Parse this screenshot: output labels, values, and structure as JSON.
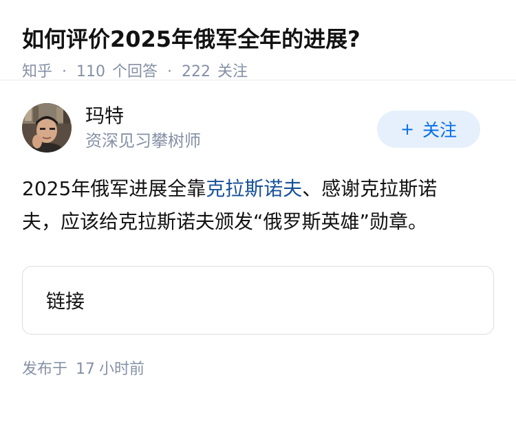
{
  "question": {
    "title": "如何评价2025年俄军全年的进展?",
    "source": "知乎",
    "answer_count": "110",
    "answer_label": "个回答",
    "follower_count": "222",
    "follower_label": "关注",
    "separator": "·"
  },
  "answer": {
    "author": {
      "name": "玛特",
      "bio": "资深见习攀树师",
      "avatar_icon": "user-avatar"
    },
    "follow_button": {
      "icon": "+",
      "label": "关注"
    },
    "content": {
      "part1": "2025年俄军进展全靠",
      "link_text": "克拉斯诺夫",
      "part2": "、感谢克拉斯诺夫，应该给克拉斯诺夫颁发“俄罗斯英雄”勋章。"
    },
    "link_card": {
      "label": "链接"
    },
    "publish": {
      "prefix": "发布于",
      "number": "17",
      "unit": "小时前"
    }
  },
  "colors": {
    "accent": "#056de8",
    "link": "#175199",
    "meta": "#8590a6",
    "follow_bg": "#e5f0fc"
  }
}
